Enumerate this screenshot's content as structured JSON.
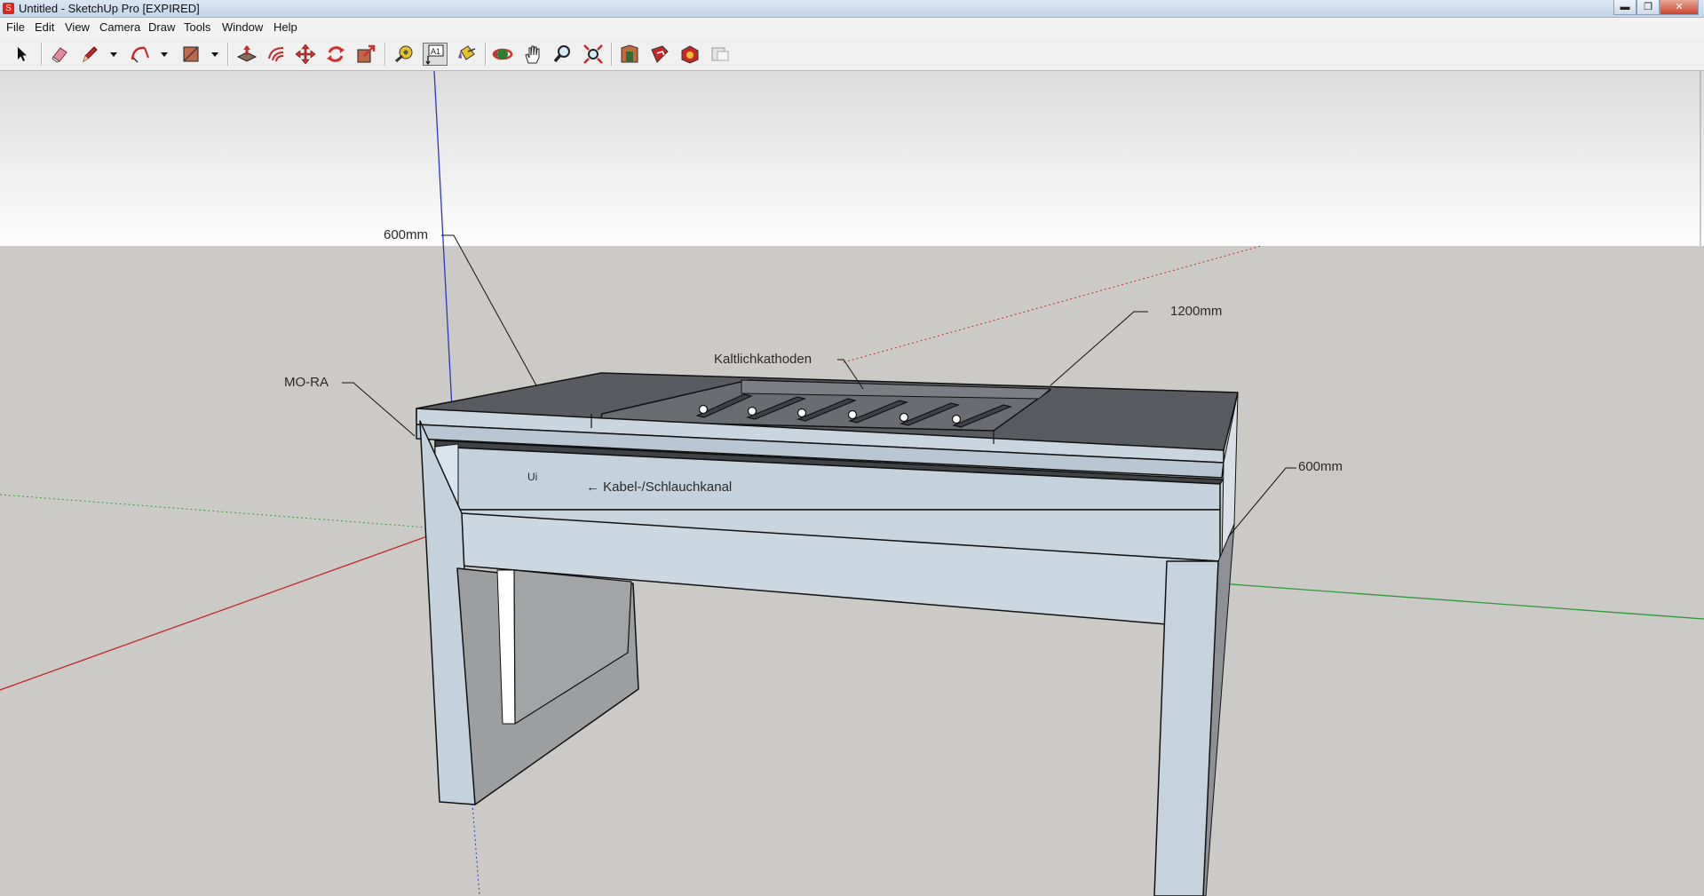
{
  "window": {
    "title": "Untitled - SketchUp Pro [EXPIRED]",
    "buttons": {
      "minimize": "▬",
      "maximize": "❐",
      "close": "✕"
    }
  },
  "menu": [
    "File",
    "Edit",
    "View",
    "Camera",
    "Draw",
    "Tools",
    "Window",
    "Help"
  ],
  "toolbar": {
    "tools": [
      {
        "name": "select-tool-icon"
      },
      {
        "name": "eraser-tool-icon"
      },
      {
        "name": "pencil-line-tool-icon"
      },
      {
        "name": "arc-tool-icon"
      },
      {
        "name": "rectangle-tool-icon"
      },
      {
        "name": "push-pull-tool-icon"
      },
      {
        "name": "offset-tool-icon"
      },
      {
        "name": "move-tool-icon"
      },
      {
        "name": "rotate-tool-icon"
      },
      {
        "name": "scale-tool-icon"
      },
      {
        "name": "tape-measure-tool-icon"
      },
      {
        "name": "text-tool-icon",
        "active": true
      },
      {
        "name": "paint-bucket-tool-icon"
      },
      {
        "name": "orbit-tool-icon"
      },
      {
        "name": "pan-tool-icon"
      },
      {
        "name": "zoom-tool-icon"
      },
      {
        "name": "zoom-extents-tool-icon"
      },
      {
        "name": "3d-warehouse-icon"
      },
      {
        "name": "share-model-icon"
      },
      {
        "name": "extension-warehouse-icon"
      },
      {
        "name": "send-to-layout-icon"
      }
    ]
  },
  "scene": {
    "sky_color": "#eeefef",
    "ground_color": "#cbcac6",
    "axis_colors": {
      "red": "#c8242a",
      "green": "#2f9a3a",
      "blue": "#2d36c4"
    },
    "annotations": {
      "top_depth": "600mm",
      "top_width": "1200mm",
      "side_depth": "600mm",
      "mora": "MO-RA",
      "cathodes": "Kaltlichkathoden",
      "cable_channel": "←  Kabel-/Schlauchkanal",
      "small_mark": "Ui"
    }
  }
}
